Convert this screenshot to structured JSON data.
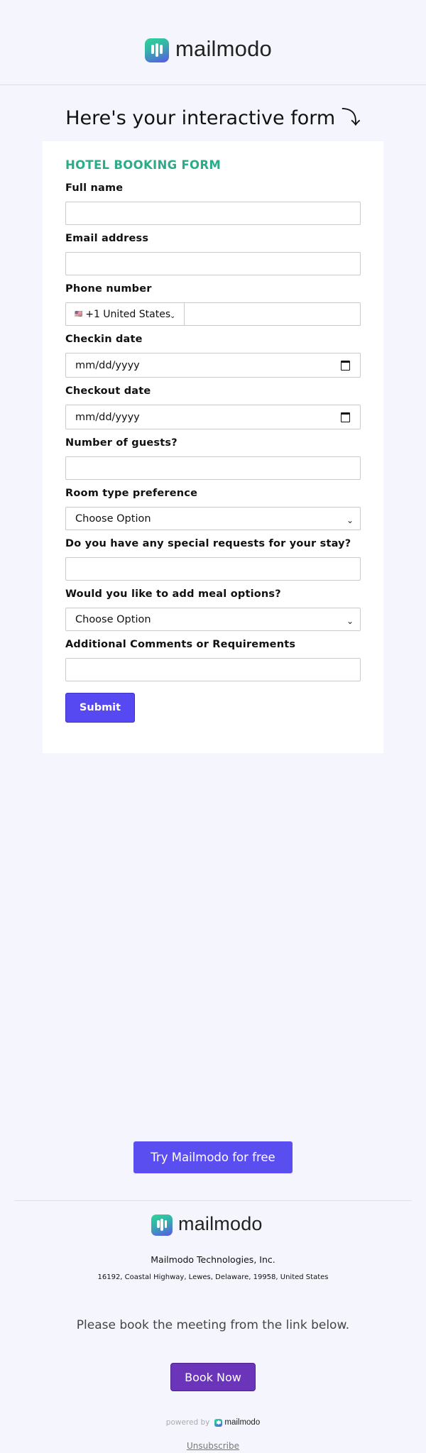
{
  "brand": {
    "name": "mailmodo",
    "gradient_top": "#2ed39a",
    "gradient_bottom": "#5a56e8"
  },
  "intro": {
    "heading": "Here's your interactive form ⤵"
  },
  "form": {
    "title": "HOTEL BOOKING FORM",
    "title_color": "#2aac88",
    "fields": {
      "full_name": {
        "label": "Full name",
        "value": ""
      },
      "email": {
        "label": "Email address",
        "value": ""
      },
      "phone": {
        "label": "Phone number",
        "country_flag": "🇺🇸",
        "country": "+1 United States",
        "value": ""
      },
      "checkin": {
        "label": "Checkin date",
        "placeholder": "mm/dd/yyyy"
      },
      "checkout": {
        "label": "Checkout date",
        "placeholder": "mm/dd/yyyy"
      },
      "guests": {
        "label": "Number of guests?",
        "value": ""
      },
      "room_type": {
        "label": "Room type preference",
        "selected": "Choose Option"
      },
      "special_requests": {
        "label": "Do you have any special requests for your stay?",
        "value": ""
      },
      "meal_options": {
        "label": "Would you like to add meal options?",
        "selected": "Choose Option"
      },
      "comments": {
        "label": "Additional Comments or Requirements",
        "value": ""
      }
    },
    "submit_label": "Submit",
    "submit_color": "#5749f2"
  },
  "footer": {
    "cta_label": "Try Mailmodo for free",
    "company": "Mailmodo Technologies, Inc.",
    "address": "16192, Coastal Highway, Lewes, Delaware, 19958, United States",
    "meeting_text": "Please book the meeting from the link below.",
    "book_label": "Book Now",
    "book_color": "#6a35b8",
    "powered_by": "powered by",
    "powered_brand": "mailmodo",
    "unsubscribe": "Unsubscribe"
  }
}
